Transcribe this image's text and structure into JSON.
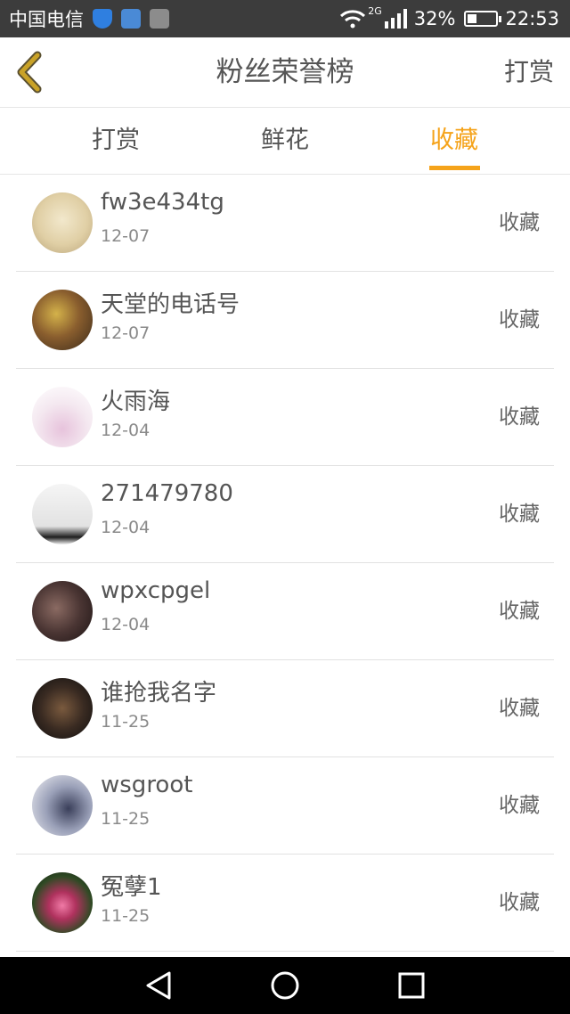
{
  "status_bar": {
    "carrier": "中国电信",
    "network": "2G",
    "battery": "32%",
    "battery_level": 0.32,
    "time": "22:53",
    "icons": [
      "shield-icon",
      "message-icon",
      "image-icon",
      "wifi-icon",
      "signal-icon",
      "battery-icon"
    ]
  },
  "header": {
    "title": "粉丝荣誉榜",
    "right_action": "打赏",
    "back_icon": "chevron-left-icon"
  },
  "tabs": [
    {
      "label": "打赏",
      "active": false
    },
    {
      "label": "鲜花",
      "active": false
    },
    {
      "label": "收藏",
      "active": true
    }
  ],
  "list": [
    {
      "name": "fw3e434tg",
      "date": "12-07",
      "action": "收藏"
    },
    {
      "name": "天堂的电话号",
      "date": "12-07",
      "action": "收藏"
    },
    {
      "name": "火雨海",
      "date": "12-04",
      "action": "收藏"
    },
    {
      "name": "271479780",
      "date": "12-04",
      "action": "收藏"
    },
    {
      "name": "wpxcpgel",
      "date": "12-04",
      "action": "收藏"
    },
    {
      "name": "谁抢我名字",
      "date": "11-25",
      "action": "收藏"
    },
    {
      "name": "wsgroot",
      "date": "11-25",
      "action": "收藏"
    },
    {
      "name": "冤孽1",
      "date": "11-25",
      "action": "收藏"
    }
  ],
  "colors": {
    "accent": "#f5a31a",
    "status_bar": "#3c3c3c",
    "back_icon": "#c9a227",
    "nav_bar": "#000000"
  },
  "nav_bar": {
    "icons": [
      "back-triangle-icon",
      "home-circle-icon",
      "recents-square-icon"
    ]
  }
}
